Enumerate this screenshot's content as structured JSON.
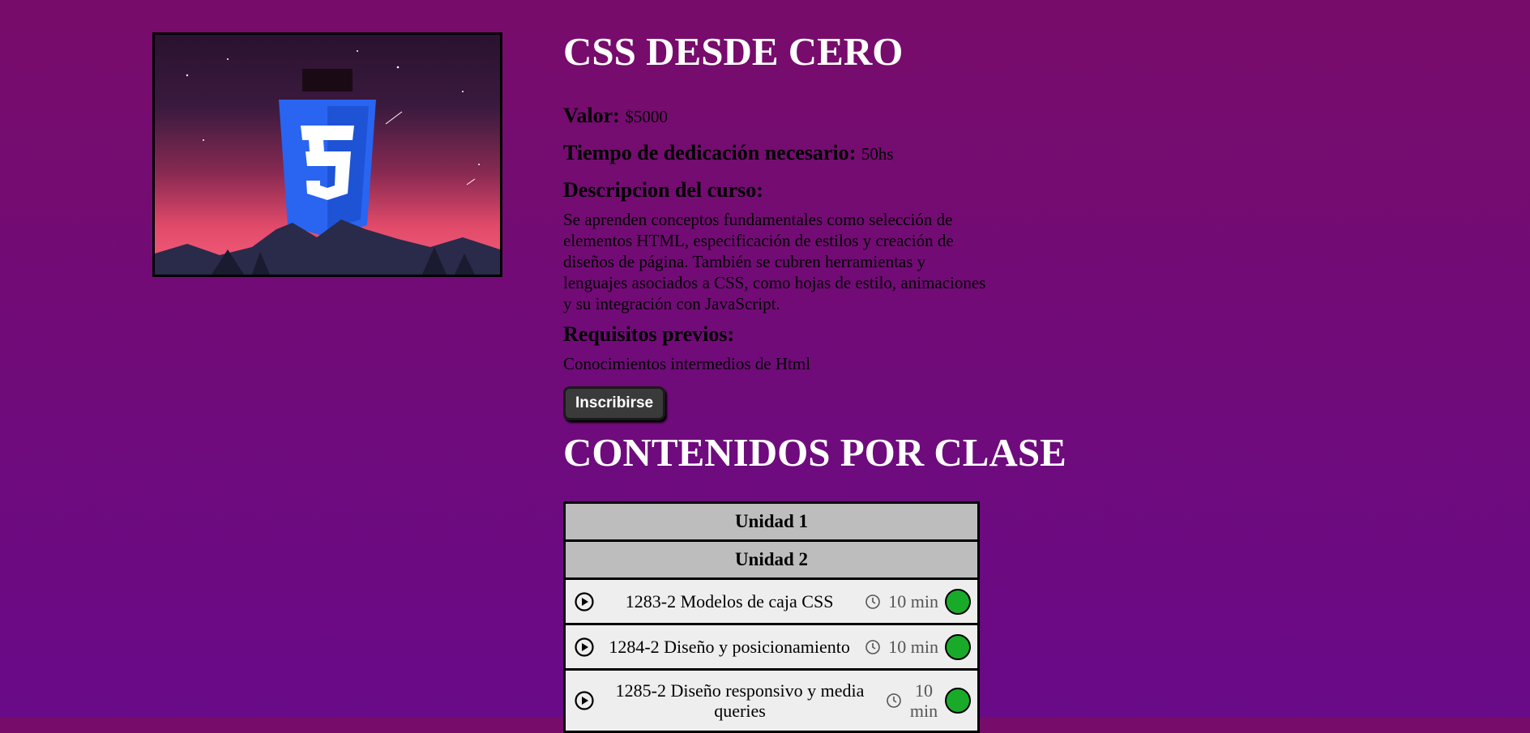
{
  "course": {
    "title": "CSS DESDE CERO",
    "image_alt": "CSS",
    "price_label": "Valor:",
    "price": "$5000",
    "time_label": "Tiempo de dedicación necesario:",
    "time": "50hs",
    "description_label": "Descripcion del curso:",
    "description": "Se aprenden conceptos fundamentales como selección de elementos HTML, especificación de estilos y creación de diseños de página. También se cubren herramientas y lenguajes asociados a CSS, como hojas de estilo, animaciones y su integración con JavaScript.",
    "requirements_label": "Requisitos previos:",
    "requirements": "Conocimientos intermedios de Html",
    "enroll_label": "Inscribirse"
  },
  "contents": {
    "title": "CONTENIDOS POR CLASE",
    "units": [
      {
        "label": "Unidad 1"
      },
      {
        "label": "Unidad 2"
      }
    ],
    "classes": [
      {
        "name": "1283-2 Modelos de caja CSS",
        "duration": "10 min",
        "status_color": "#1aaa2a"
      },
      {
        "name": "1284-2 Diseño y posicionamiento",
        "duration": "10 min",
        "status_color": "#1aaa2a"
      },
      {
        "name": "1285-2 Diseño responsivo y media queries",
        "duration": "10 min",
        "status_color": "#1aaa2a"
      }
    ]
  },
  "colors": {
    "background_top": "#780c6a",
    "background_bottom": "#690a88",
    "css_logo_blue": "#2965f1",
    "status_complete": "#1aaa2a"
  }
}
